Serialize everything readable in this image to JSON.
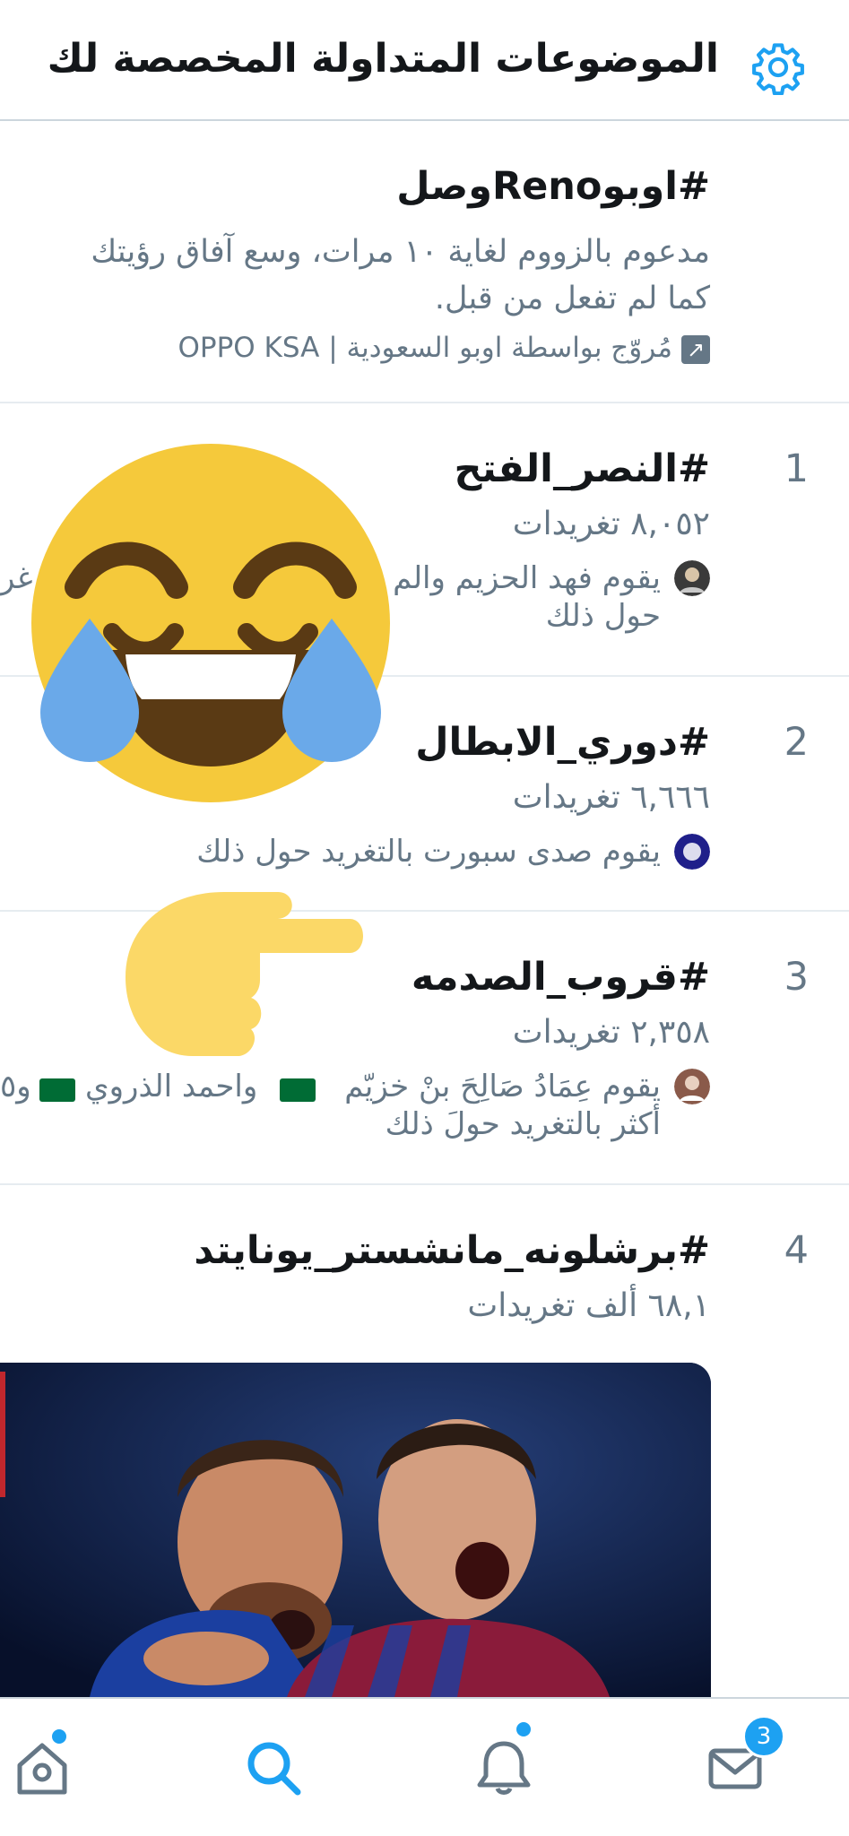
{
  "header": {
    "title": "الموضوعات المتداولة المخصصة لك",
    "settings_icon": "gear-icon"
  },
  "promoted": {
    "hashtag": "#اوبوRenoوصل",
    "line1": "مدعوم بالزووم لغاية ١٠ مرات، وسع آفاق رؤيتك",
    "line2": "كما لم تفعل من قبل.",
    "promoted_by": "مُروّج بواسطة اوبو السعودية | OPPO KSA"
  },
  "trends": [
    {
      "rank": "1",
      "hashtag": "#النصر_الفتح",
      "count": "٨,٠٥٢ تغريدات",
      "desc1": "يقوم فهد الحزيم والم",
      "desc1_edge": "غر",
      "desc2": "حول ذلك"
    },
    {
      "rank": "2",
      "hashtag": "#دوري_الابطال",
      "count": "٦,٦٦٦ تغريدات",
      "desc1": "يقوم صدى سبورت بالتغريد حول ذلك"
    },
    {
      "rank": "3",
      "hashtag": "#قروب_الصدمه",
      "count": "٢,٣٥٨ تغريدات",
      "desc1": "يقوم عِمَادُ صَالِحَ بنْ خزيّم",
      "desc1_mid": "واحمد الذروي",
      "desc1_edge": "و٥",
      "desc2": "أكثر بالتغريد حولَ ذلك"
    },
    {
      "rank": "4",
      "hashtag": "#برشلونه_مانشستر_يونايتد",
      "count": "٦٨,١ ألف تغريدات"
    }
  ],
  "bottom_nav": {
    "home_icon": "home-icon",
    "search_icon": "search-icon",
    "notifications_icon": "bell-icon",
    "messages_icon": "mail-icon",
    "messages_badge": "3"
  },
  "colors": {
    "accent": "#1da1f2",
    "secondary_text": "#657786",
    "divider": "#e6ecf0"
  }
}
